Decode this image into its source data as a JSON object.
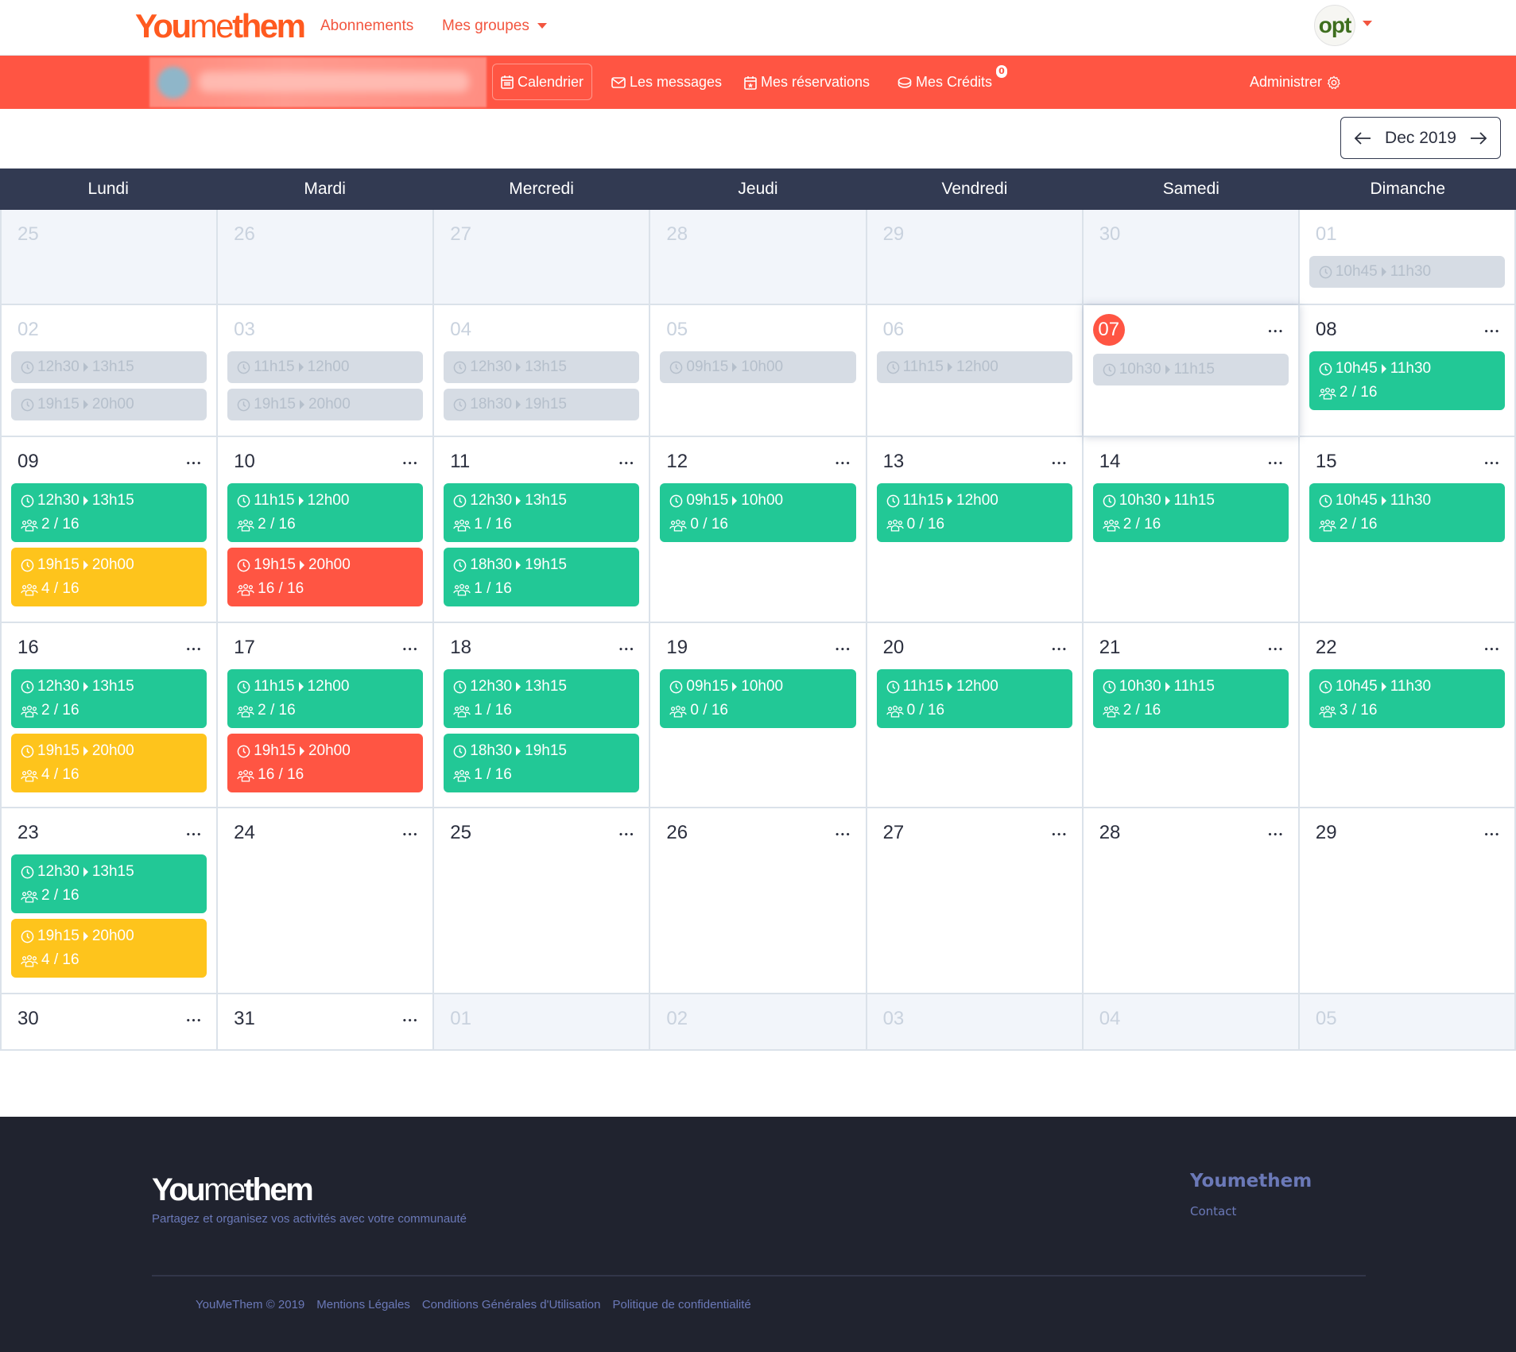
{
  "header": {
    "logo_parts": [
      "You",
      "me",
      "them"
    ],
    "nav": [
      {
        "label": "Abonnements"
      },
      {
        "label": "Mes groupes",
        "has_dropdown": true
      }
    ],
    "avatar_text": "opt"
  },
  "subnav": {
    "items": [
      {
        "label": "Calendrier",
        "icon": "calendar-icon",
        "active": true
      },
      {
        "label": "Les messages",
        "icon": "envelope-icon"
      },
      {
        "label": "Mes réservations",
        "icon": "calendar-star-icon"
      },
      {
        "label": "Mes Crédits",
        "icon": "coins-icon",
        "badge": "0"
      }
    ],
    "admin_label": "Administrer"
  },
  "calendar": {
    "month_label": "Dec 2019",
    "weekdays": [
      "Lundi",
      "Mardi",
      "Mercredi",
      "Jeudi",
      "Vendredi",
      "Samedi",
      "Dimanche"
    ],
    "colors": {
      "available": "#22c896",
      "medium": "#fec41c",
      "full": "#ff5543",
      "past": "#d6dce4",
      "today": "#ff5543",
      "header": "#323a52"
    },
    "weeks": [
      [
        {
          "day": "25",
          "other": true,
          "events": []
        },
        {
          "day": "26",
          "other": true,
          "events": []
        },
        {
          "day": "27",
          "other": true,
          "events": []
        },
        {
          "day": "28",
          "other": true,
          "events": []
        },
        {
          "day": "29",
          "other": true,
          "events": []
        },
        {
          "day": "30",
          "other": true,
          "events": []
        },
        {
          "day": "01",
          "past": true,
          "events": [
            {
              "start": "10h45",
              "end": "11h30",
              "status": "past"
            }
          ]
        }
      ],
      [
        {
          "day": "02",
          "past": true,
          "events": [
            {
              "start": "12h30",
              "end": "13h15",
              "status": "past"
            },
            {
              "start": "19h15",
              "end": "20h00",
              "status": "past"
            }
          ]
        },
        {
          "day": "03",
          "past": true,
          "events": [
            {
              "start": "11h15",
              "end": "12h00",
              "status": "past"
            },
            {
              "start": "19h15",
              "end": "20h00",
              "status": "past"
            }
          ]
        },
        {
          "day": "04",
          "past": true,
          "events": [
            {
              "start": "12h30",
              "end": "13h15",
              "status": "past"
            },
            {
              "start": "18h30",
              "end": "19h15",
              "status": "past"
            }
          ]
        },
        {
          "day": "05",
          "past": true,
          "events": [
            {
              "start": "09h15",
              "end": "10h00",
              "status": "past"
            }
          ]
        },
        {
          "day": "06",
          "past": true,
          "events": [
            {
              "start": "11h15",
              "end": "12h00",
              "status": "past"
            }
          ]
        },
        {
          "day": "07",
          "today": true,
          "more": true,
          "events": [
            {
              "start": "10h30",
              "end": "11h15",
              "status": "past"
            }
          ]
        },
        {
          "day": "08",
          "more": true,
          "events": [
            {
              "start": "10h45",
              "end": "11h30",
              "status": "green",
              "count": "2 / 16"
            }
          ]
        }
      ],
      [
        {
          "day": "09",
          "more": true,
          "events": [
            {
              "start": "12h30",
              "end": "13h15",
              "status": "green",
              "count": "2 / 16"
            },
            {
              "start": "19h15",
              "end": "20h00",
              "status": "yellow",
              "count": "4 / 16"
            }
          ]
        },
        {
          "day": "10",
          "more": true,
          "events": [
            {
              "start": "11h15",
              "end": "12h00",
              "status": "green",
              "count": "2 / 16"
            },
            {
              "start": "19h15",
              "end": "20h00",
              "status": "red",
              "count": "16 / 16"
            }
          ]
        },
        {
          "day": "11",
          "more": true,
          "events": [
            {
              "start": "12h30",
              "end": "13h15",
              "status": "green",
              "count": "1 / 16"
            },
            {
              "start": "18h30",
              "end": "19h15",
              "status": "green",
              "count": "1 / 16"
            }
          ]
        },
        {
          "day": "12",
          "more": true,
          "events": [
            {
              "start": "09h15",
              "end": "10h00",
              "status": "green",
              "count": "0 / 16"
            }
          ]
        },
        {
          "day": "13",
          "more": true,
          "events": [
            {
              "start": "11h15",
              "end": "12h00",
              "status": "green",
              "count": "0 / 16"
            }
          ]
        },
        {
          "day": "14",
          "more": true,
          "events": [
            {
              "start": "10h30",
              "end": "11h15",
              "status": "green",
              "count": "2 / 16"
            }
          ]
        },
        {
          "day": "15",
          "more": true,
          "events": [
            {
              "start": "10h45",
              "end": "11h30",
              "status": "green",
              "count": "2 / 16"
            }
          ]
        }
      ],
      [
        {
          "day": "16",
          "more": true,
          "events": [
            {
              "start": "12h30",
              "end": "13h15",
              "status": "green",
              "count": "2 / 16"
            },
            {
              "start": "19h15",
              "end": "20h00",
              "status": "yellow",
              "count": "4 / 16"
            }
          ]
        },
        {
          "day": "17",
          "more": true,
          "events": [
            {
              "start": "11h15",
              "end": "12h00",
              "status": "green",
              "count": "2 / 16"
            },
            {
              "start": "19h15",
              "end": "20h00",
              "status": "red",
              "count": "16 / 16"
            }
          ]
        },
        {
          "day": "18",
          "more": true,
          "events": [
            {
              "start": "12h30",
              "end": "13h15",
              "status": "green",
              "count": "1 / 16"
            },
            {
              "start": "18h30",
              "end": "19h15",
              "status": "green",
              "count": "1 / 16"
            }
          ]
        },
        {
          "day": "19",
          "more": true,
          "events": [
            {
              "start": "09h15",
              "end": "10h00",
              "status": "green",
              "count": "0 / 16"
            }
          ]
        },
        {
          "day": "20",
          "more": true,
          "events": [
            {
              "start": "11h15",
              "end": "12h00",
              "status": "green",
              "count": "0 / 16"
            }
          ]
        },
        {
          "day": "21",
          "more": true,
          "events": [
            {
              "start": "10h30",
              "end": "11h15",
              "status": "green",
              "count": "2 / 16"
            }
          ]
        },
        {
          "day": "22",
          "more": true,
          "events": [
            {
              "start": "10h45",
              "end": "11h30",
              "status": "green",
              "count": "3 / 16"
            }
          ]
        }
      ],
      [
        {
          "day": "23",
          "more": true,
          "events": [
            {
              "start": "12h30",
              "end": "13h15",
              "status": "green",
              "count": "2 / 16"
            },
            {
              "start": "19h15",
              "end": "20h00",
              "status": "yellow",
              "count": "4 / 16"
            }
          ]
        },
        {
          "day": "24",
          "more": true,
          "events": []
        },
        {
          "day": "25",
          "more": true,
          "events": []
        },
        {
          "day": "26",
          "more": true,
          "events": []
        },
        {
          "day": "27",
          "more": true,
          "events": []
        },
        {
          "day": "28",
          "more": true,
          "events": []
        },
        {
          "day": "29",
          "more": true,
          "events": []
        }
      ],
      [
        {
          "day": "30",
          "more": true,
          "events": []
        },
        {
          "day": "31",
          "more": true,
          "events": []
        },
        {
          "day": "01",
          "other": true,
          "events": []
        },
        {
          "day": "02",
          "other": true,
          "events": []
        },
        {
          "day": "03",
          "other": true,
          "events": []
        },
        {
          "day": "04",
          "other": true,
          "events": []
        },
        {
          "day": "05",
          "other": true,
          "events": []
        }
      ]
    ]
  },
  "footer": {
    "logo_parts": [
      "You",
      "me",
      "them"
    ],
    "tagline": "Partagez et organisez vos activités avec votre communauté",
    "brand": "Youmethem",
    "contact": "Contact",
    "links": [
      "YouMeThem © 2019",
      "Mentions Légales",
      "Conditions Générales d'Utilisation",
      "Politique de confidentialité"
    ]
  }
}
